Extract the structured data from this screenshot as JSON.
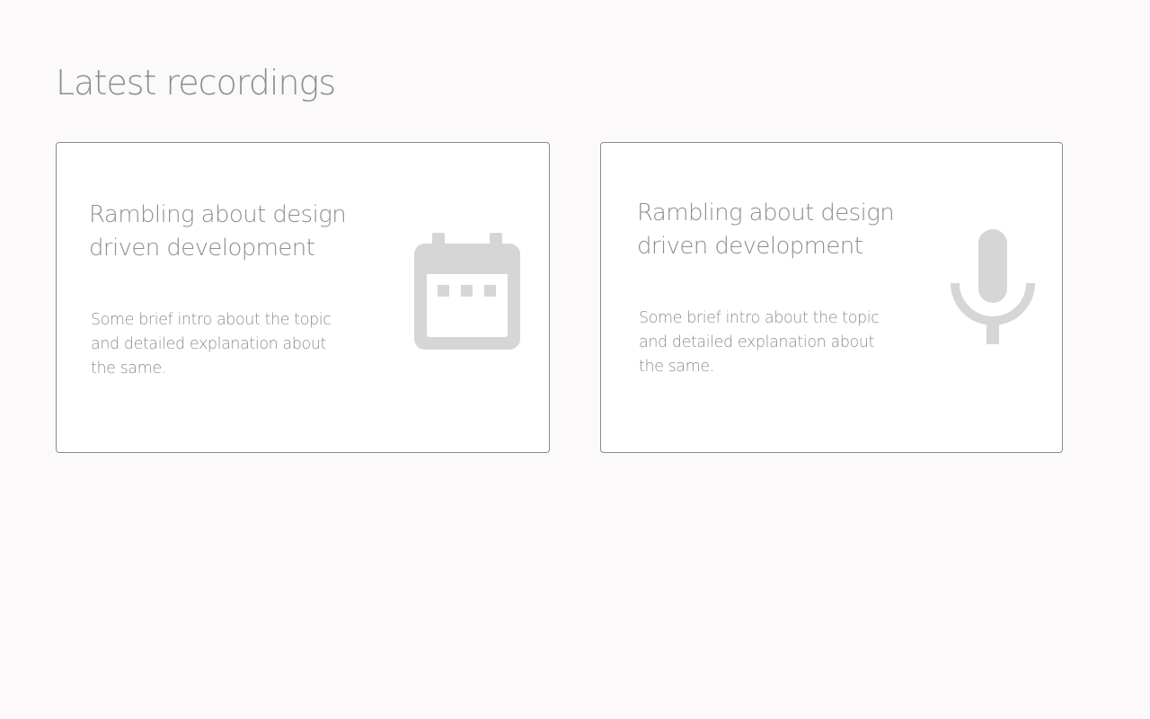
{
  "page": {
    "title": "Latest recordings",
    "background": "#fbf9fa",
    "text_color": "#8e8e8e",
    "icon_color": "#d6d6d6"
  },
  "recordings": [
    {
      "title": "Rambling about design driven development",
      "description": "Some brief intro about the topic and detailed explanation about the same.",
      "icon": "calendar-icon"
    },
    {
      "title": "Rambling about design driven development",
      "description": "Some brief intro about the topic and detailed explanation about the same.",
      "icon": "microphone-icon"
    }
  ]
}
